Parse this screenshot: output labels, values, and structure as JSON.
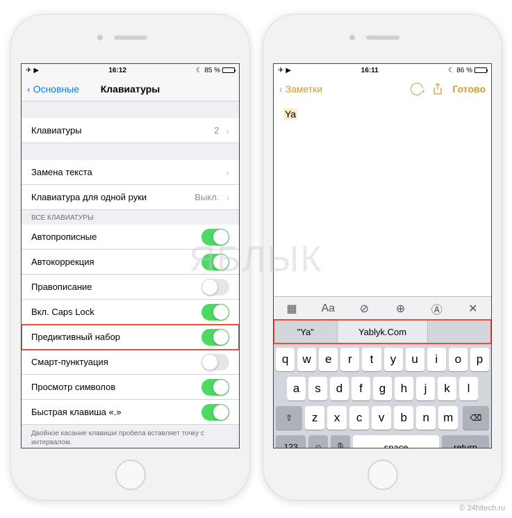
{
  "watermark": "ЯБЛЫК",
  "credit": "© 24hitech.ru",
  "left": {
    "status": {
      "time": "16:12",
      "battery": "85 %"
    },
    "nav": {
      "back": "Основные",
      "title": "Клавиатуры"
    },
    "rows": {
      "keyboards": {
        "label": "Клавиатуры",
        "value": "2"
      },
      "text_replace": {
        "label": "Замена текста"
      },
      "one_hand": {
        "label": "Клавиатура для одной руки",
        "value": "Выкл."
      }
    },
    "section_header": "ВСЕ КЛАВИАТУРЫ",
    "toggles": {
      "auto_caps": {
        "label": "Автопрописные",
        "on": true
      },
      "auto_correct": {
        "label": "Автокоррекция",
        "on": true
      },
      "spell_check": {
        "label": "Правописание",
        "on": false
      },
      "caps_lock": {
        "label": "Вкл. Caps Lock",
        "on": true
      },
      "predictive": {
        "label": "Предиктивный набор",
        "on": true
      },
      "smart_punct": {
        "label": "Смарт-пунктуация",
        "on": false
      },
      "char_preview": {
        "label": "Просмотр символов",
        "on": true
      },
      "shortcut": {
        "label": "Быстрая клавиша «.»",
        "on": true
      }
    },
    "footer": "Двойное касание клавиши пробела вставляет точку с интервалом."
  },
  "right": {
    "status": {
      "time": "16:11",
      "battery": "86 %"
    },
    "nav": {
      "back": "Заметки",
      "done": "Готово"
    },
    "note_text": "Ya",
    "format_labels": {
      "aa": "Aa"
    },
    "predictions": {
      "first": "\"Ya\"",
      "second": "Yablyk.Com"
    },
    "keyboard": {
      "row1": [
        "q",
        "w",
        "e",
        "r",
        "t",
        "y",
        "u",
        "i",
        "o",
        "p"
      ],
      "row2": [
        "a",
        "s",
        "d",
        "f",
        "g",
        "h",
        "j",
        "k",
        "l"
      ],
      "row3": [
        "z",
        "x",
        "c",
        "v",
        "b",
        "n",
        "m"
      ],
      "row4": {
        "num": "123",
        "space": "space",
        "return": "return"
      }
    }
  }
}
